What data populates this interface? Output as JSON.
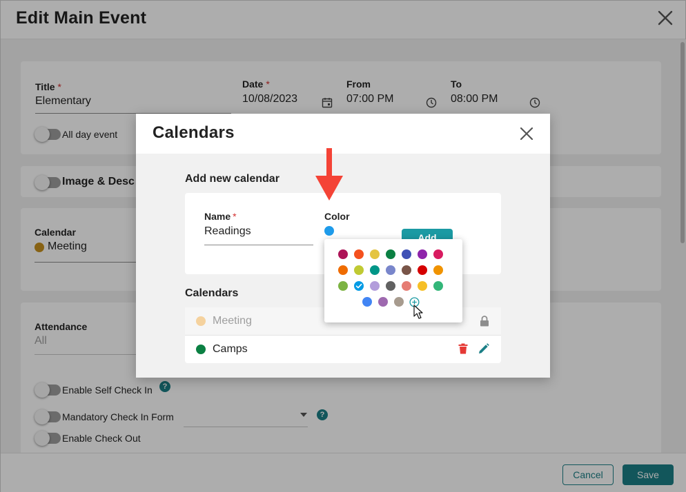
{
  "base": {
    "title": "Edit Main Event",
    "title_field": {
      "label": "Title",
      "required": "*",
      "value": "Elementary"
    },
    "all_day": {
      "label": "All day event"
    },
    "date_field": {
      "label": "Date",
      "required": "*",
      "value": "10/08/2023"
    },
    "from_field": {
      "label": "From",
      "value": "07:00 PM"
    },
    "to_field": {
      "label": "To",
      "value": "08:00 PM"
    },
    "image_section": {
      "label": "Image & Desc"
    },
    "calendar_field": {
      "label": "Calendar",
      "value": "Meeting",
      "dot_color": "#c8911e"
    },
    "attendance_field": {
      "label": "Attendance",
      "value": "All"
    },
    "self_checkin": {
      "label": "Enable Self Check In",
      "help": "?"
    },
    "mandatory_form": {
      "label": "Mandatory Check In Form",
      "help": "?"
    },
    "checkout": {
      "label": "Enable Check Out"
    },
    "cancel_label": "Cancel",
    "save_label": "Save"
  },
  "modal": {
    "title": "Calendars",
    "add_section_title": "Add new calendar",
    "name_field": {
      "label": "Name",
      "required": "*",
      "value": "Readings"
    },
    "color_field": {
      "label": "Color",
      "selected_color": "#1e9bea"
    },
    "add_label": "Add",
    "list_title": "Calendars",
    "calendars": [
      {
        "name": "Meeting",
        "color": "#f5d29e",
        "disabled": true
      },
      {
        "name": "Camps",
        "color": "#0b8043",
        "disabled": false
      }
    ]
  },
  "picker": {
    "rows": [
      [
        "#ad1457",
        "#f4511e",
        "#e4c441",
        "#0b8043",
        "#3f51b5",
        "#8e24aa",
        "#d81b60"
      ],
      [
        "#ef6c00",
        "#c0ca33",
        "#009688",
        "#7986cb",
        "#795548",
        "#d50000",
        "#f09300"
      ],
      [
        "#7cb342",
        "#039be5",
        "#b39ddb",
        "#616161",
        "#e67c73",
        "#f6bf26",
        "#33b679"
      ],
      [
        "#4285f4",
        "#9e69af",
        "#a79b8e"
      ]
    ],
    "selected": "#039be5",
    "accent": "#1b9aa3"
  },
  "colors": {
    "primary": "#1b7f86",
    "required": "#d32f2f",
    "delete": "#e53935",
    "arrow": "#f44336"
  },
  "icons": [
    "close-icon",
    "calendar-icon",
    "clock-icon",
    "lock-icon",
    "trash-icon",
    "pencil-icon",
    "plus-circle-icon",
    "dropdown-arrow-icon",
    "check-icon",
    "cursor-icon"
  ]
}
